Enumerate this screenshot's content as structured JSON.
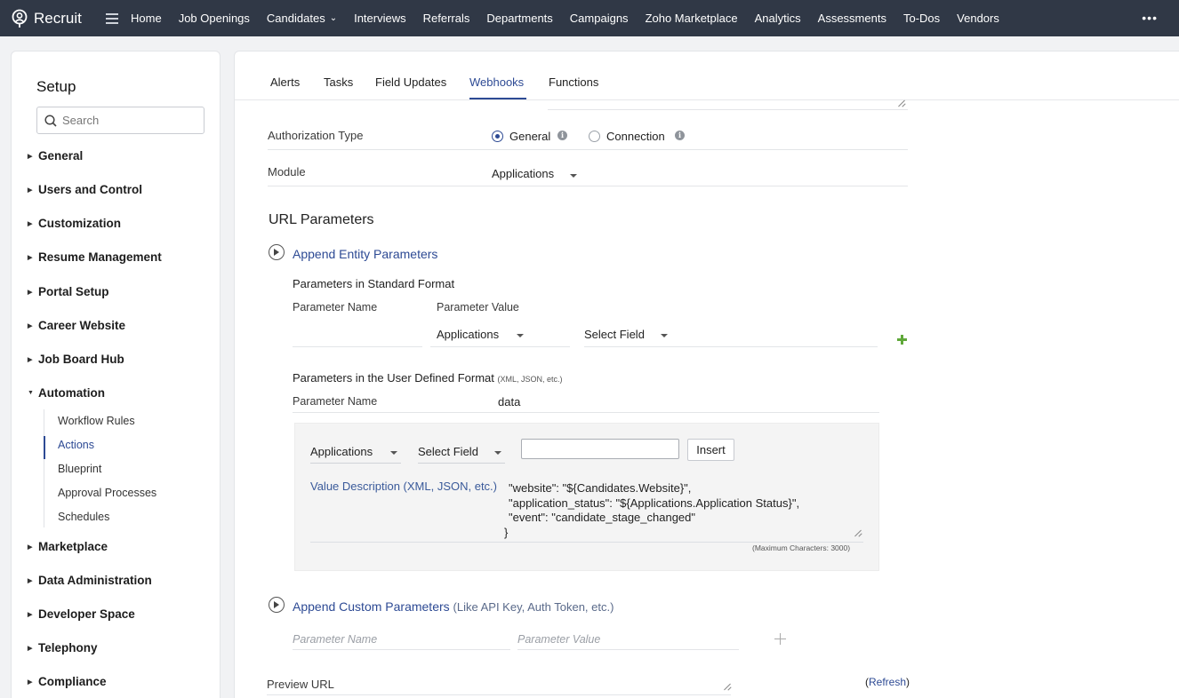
{
  "topbar": {
    "app_name": "Recruit",
    "nav": [
      {
        "label": "Home"
      },
      {
        "label": "Job Openings"
      },
      {
        "label": "Candidates"
      },
      {
        "label": "Interviews"
      },
      {
        "label": "Referrals"
      },
      {
        "label": "Departments"
      },
      {
        "label": "Campaigns"
      },
      {
        "label": "Zoho Marketplace"
      },
      {
        "label": "Analytics"
      },
      {
        "label": "Assessments"
      },
      {
        "label": "To-Dos"
      },
      {
        "label": "Vendors"
      }
    ],
    "more": "•••"
  },
  "sidebar": {
    "title": "Setup",
    "search_placeholder": "Search",
    "items": [
      {
        "label": "General"
      },
      {
        "label": "Users and Control"
      },
      {
        "label": "Customization"
      },
      {
        "label": "Resume Management"
      },
      {
        "label": "Portal Setup"
      },
      {
        "label": "Career Website"
      },
      {
        "label": "Job Board Hub"
      },
      {
        "label": "Automation"
      },
      {
        "label": "Marketplace"
      },
      {
        "label": "Data Administration"
      },
      {
        "label": "Developer Space"
      },
      {
        "label": "Telephony"
      },
      {
        "label": "Compliance"
      }
    ],
    "automation_subitems": [
      {
        "label": "Workflow Rules"
      },
      {
        "label": "Actions"
      },
      {
        "label": "Blueprint"
      },
      {
        "label": "Approval Processes"
      },
      {
        "label": "Schedules"
      }
    ]
  },
  "tabs": [
    {
      "label": "Alerts"
    },
    {
      "label": "Tasks"
    },
    {
      "label": "Field Updates"
    },
    {
      "label": "Webhooks"
    },
    {
      "label": "Functions"
    }
  ],
  "form": {
    "auth_label": "Authorization Type",
    "auth_general": "General",
    "auth_connection": "Connection",
    "module_label": "Module",
    "module_value": "Applications",
    "url_params_heading": "URL Parameters",
    "append_entity": "Append Entity Parameters",
    "std_format_heading": "Parameters in Standard Format",
    "param_name_header": "Parameter Name",
    "param_value_header": "Parameter Value",
    "std_module_value": "Applications",
    "std_field_value": "Select Field",
    "user_format_heading": "Parameters in the User Defined Format",
    "user_format_note": "(XML, JSON, etc.)",
    "user_param_name_label": "Parameter Name",
    "user_param_name_value": "data",
    "ud_module_value": "Applications",
    "ud_field_value": "Select Field",
    "insert_button": "Insert",
    "value_desc_label": "Value Description (XML, JSON, etc.)",
    "value_desc_lines": [
      "\"website\": \"${Candidates.Website}\",",
      "\"application_status\": \"${Applications.Application Status}\",",
      "\"event\": \"candidate_stage_changed\"",
      "}"
    ],
    "max_chars": "(Maximum Characters: 3000)",
    "append_custom": "Append Custom Parameters",
    "append_custom_note": "(Like API Key, Auth Token, etc.)",
    "custom_param_name_placeholder": "Parameter Name",
    "custom_param_value_placeholder": "Parameter Value",
    "preview_url_label": "Preview URL",
    "refresh_open": "(",
    "refresh_link": "Refresh",
    "refresh_close": ")"
  },
  "colors": {
    "topbar": "#303846",
    "accent": "#2d4a94",
    "plus_green": "#5fa83a"
  }
}
